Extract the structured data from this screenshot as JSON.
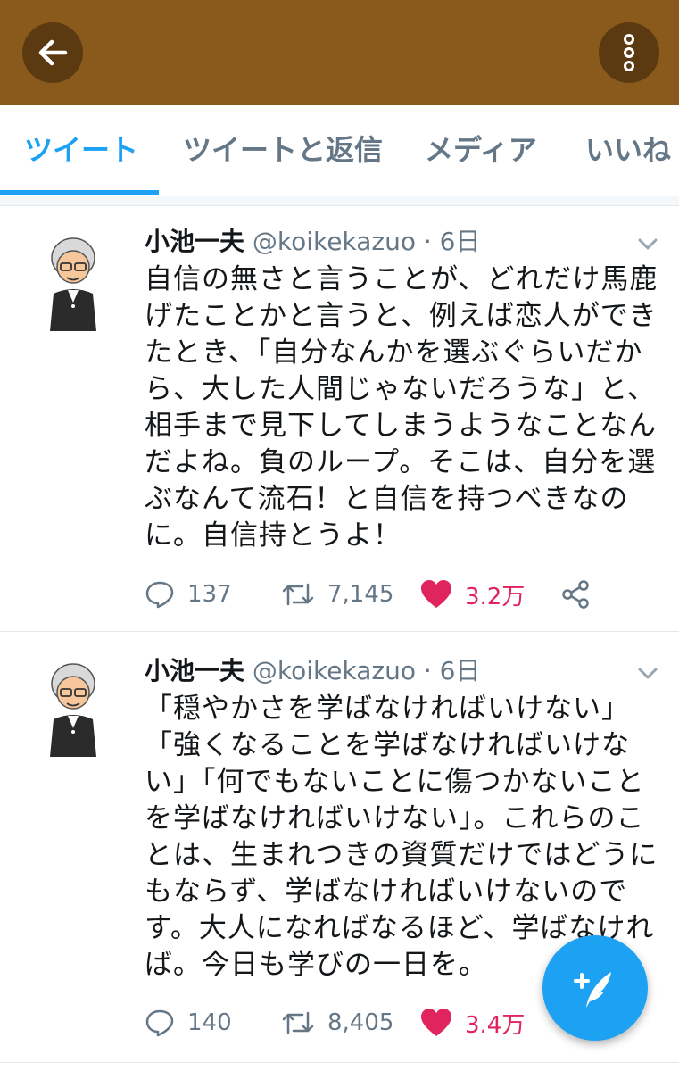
{
  "app": {
    "back_icon": "arrow-left-icon",
    "more_icon": "more-vertical-icon",
    "bar_color": "#8a5a1c",
    "accent": "#1da1f2",
    "like_color": "#e0245e"
  },
  "tabs": [
    {
      "label": "ツイート",
      "active": true
    },
    {
      "label": "ツイートと返信",
      "active": false
    },
    {
      "label": "メディア",
      "active": false
    },
    {
      "label": "いいね",
      "active": false
    }
  ],
  "tweets": [
    {
      "name": "小池一夫",
      "handle": "@koikekazuo",
      "separator": "·",
      "time": "6日",
      "text": "自信の無さと言うことが、どれだけ馬鹿\nげたことかと言うと、例えば恋人ができ\nたとき、「自分なんかを選ぶぐらいだか\nら、大した人間じゃないだろうな」と、\n相手まで見下してしまうようなことなん\nだよね。負のループ。そこは、自分を選\nぶなんて流石！と自信を持つべきなの\nに。自信持とうよ！",
      "replies": "137",
      "retweets": "7,145",
      "likes": "3.2万",
      "liked": true
    },
    {
      "name": "小池一夫",
      "handle": "@koikekazuo",
      "separator": "·",
      "time": "6日",
      "text": "「穏やかさを学ばなければいけない」\n「強くなることを学ばなければいけな\nい」「何でもないことに傷つかないこと\nを学ばなければいけない」。これらのこ\nとは、生まれつきの資質だけではどうに\nもならず、学ばなければいけないので\nす。大人になればなるほど、学ばなけれ\nば。今日も学びの一日を。",
      "replies": "140",
      "retweets": "8,405",
      "likes": "3.4万",
      "liked": true
    }
  ],
  "fab": {
    "icon": "compose-tweet-icon"
  }
}
